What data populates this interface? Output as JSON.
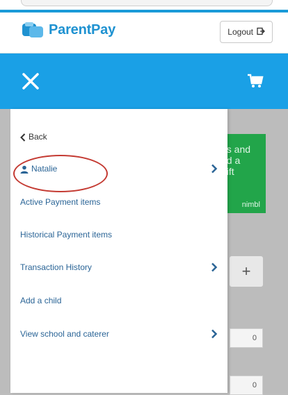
{
  "app": {
    "brand_name": "ParentPay",
    "logout_label": "Logout",
    "colors": {
      "brand_blue": "#1aa0e6",
      "link_blue": "#2a6496",
      "promo_green": "#22a54a",
      "highlight_red": "#c43a32"
    }
  },
  "icons": {
    "close": "close-icon",
    "cart": "cart-icon",
    "logout": "logout-icon",
    "back": "chevron-left-icon",
    "person": "person-icon",
    "chevron": "chevron-right-icon"
  },
  "menu": {
    "back_label": "Back",
    "child_name": "Natalie",
    "items": [
      {
        "label": "Active Payment items",
        "has_chevron": false
      },
      {
        "label": "Historical Payment items",
        "has_chevron": false
      },
      {
        "label": "Transaction History",
        "has_chevron": true
      },
      {
        "label": "Add a child",
        "has_chevron": false
      },
      {
        "label": "View school and caterer",
        "has_chevron": true
      }
    ]
  },
  "background": {
    "promo_text": "ds and\nnd a\ngift",
    "promo_brand": "nimbl",
    "plus_label": "+",
    "quantities": [
      "0",
      "0"
    ]
  }
}
